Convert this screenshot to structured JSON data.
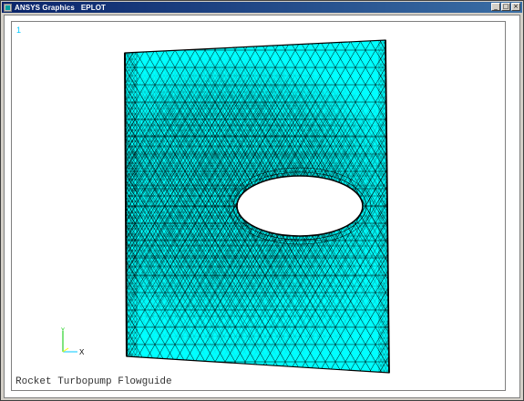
{
  "window": {
    "title": "ANSYS Graphics   EPLOT",
    "buttons": {
      "minimize": "_",
      "maximize": "□",
      "close": "×"
    }
  },
  "graphics": {
    "window_number": "1",
    "caption": "Rocket Turbopump Flowguide",
    "triad": {
      "y_label": "Y",
      "x_label": "X"
    }
  },
  "colors": {
    "mesh_fill": "#00ffff",
    "mesh_line": "#000000",
    "background": "#ffffff"
  }
}
